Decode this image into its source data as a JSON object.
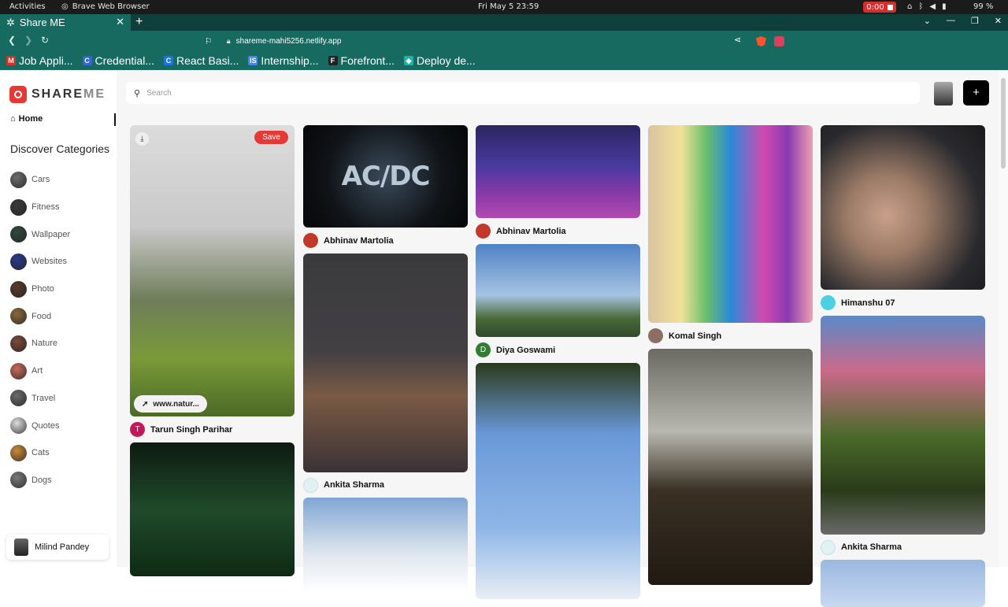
{
  "os": {
    "activities": "Activities",
    "app_name": "Brave Web Browser",
    "clock": "Fri May 5  23:59",
    "rec_time": "0:00",
    "battery": "99 %"
  },
  "browser": {
    "tab_title": "Share ME",
    "new_tab": "+",
    "url": "shareme-mahi5256.netlify.app",
    "bookmarks": [
      {
        "label": "Job Appli...",
        "icon": "mail-icon",
        "color": "#d93025",
        "glyph": "M"
      },
      {
        "label": "Credential...",
        "icon": "credential-icon",
        "color": "#3367d6",
        "glyph": "C"
      },
      {
        "label": "React Basi...",
        "icon": "course-icon",
        "color": "#1a73e8",
        "glyph": "C"
      },
      {
        "label": "Internship...",
        "icon": "internship-icon",
        "color": "#4285f4",
        "glyph": "IS"
      },
      {
        "label": "Forefront...",
        "icon": "forefront-icon",
        "color": "#222222",
        "glyph": "F"
      },
      {
        "label": "Deploy de...",
        "icon": "deploy-icon",
        "color": "#20b2aa",
        "glyph": "◆"
      }
    ]
  },
  "app": {
    "logo_a": "SHARE",
    "logo_b": "ME",
    "home": "Home",
    "discover": "Discover Categories",
    "categories": [
      {
        "label": "Cars",
        "color": "#6d6d6d"
      },
      {
        "label": "Fitness",
        "color": "#3a3a3a"
      },
      {
        "label": "Wallpaper",
        "color": "#2f4a3a"
      },
      {
        "label": "Websites",
        "color": "#2b3a8a"
      },
      {
        "label": "Photo",
        "color": "#5a3a2a"
      },
      {
        "label": "Food",
        "color": "#8a6a3a"
      },
      {
        "label": "Nature",
        "color": "#7a4a3a"
      },
      {
        "label": "Art",
        "color": "#c96a5a"
      },
      {
        "label": "Travel",
        "color": "#6a6a6a"
      },
      {
        "label": "Quotes",
        "color": "#dedede"
      },
      {
        "label": "Cats",
        "color": "#c98a3a"
      },
      {
        "label": "Dogs",
        "color": "#7a7a7a"
      }
    ],
    "user_name": "Milind Pandey",
    "search_placeholder": "Search",
    "add_label": "+",
    "save_label": "Save",
    "link_label": "www.natur..."
  },
  "feed": {
    "col1": [
      {
        "user": "Tarun Singh Parihar",
        "avatar": "T",
        "avatar_color": "#c2185b",
        "bg": "linear-gradient(180deg,#dcdcdc 0%,#c9c9c9 35%,#6f7d5a 60%,#7a9a3a 80%,#4c6a25 100%)",
        "has_save": true
      },
      {
        "user": "",
        "avatar": "",
        "avatar_color": "#fff",
        "bg": "linear-gradient(180deg,#0e1a12 0%,#1f4a2a 50%,#0f2a14 100%)"
      }
    ],
    "col2": [
      {
        "user": "Abhinav Martolia",
        "avatar": "",
        "avatar_color": "#c0392b",
        "bg": "radial-gradient(circle at 50% 50%,#3a4a5a 0%,#101418 60%,#050608 100%)",
        "art": "AC/DC"
      },
      {
        "user": "Ankita Sharma",
        "avatar": "",
        "avatar_color": "#e0f2f1",
        "bg": "linear-gradient(180deg,#3a3a3c 0%,#434044 45%,#7a5a44 65%,#3b3236 100%)"
      },
      {
        "user": "",
        "avatar": "",
        "avatar_color": "#fff",
        "bg": "linear-gradient(180deg,#7fa6d4 0%,#dfe7ee 60%,#ffffff 100%)"
      }
    ],
    "col3": [
      {
        "user": "Abhinav Martolia",
        "avatar": "",
        "avatar_color": "#c0392b",
        "bg": "linear-gradient(180deg,#2b2660 0%,#4a3aa0 45%,#8a3aa8 75%,#b24ab0 100%)"
      },
      {
        "user": "Diya Goswami",
        "avatar": "D",
        "avatar_color": "#2e7d32",
        "bg": "linear-gradient(180deg,#4f82c6 0%,#a7c3e2 55%,#4a6a3a 80%,#2f4a2a 100%)"
      },
      {
        "user": "",
        "avatar": "",
        "avatar_color": "#fff",
        "bg": "linear-gradient(180deg,#2a3a1a 0%,#6a98d8 30%,#8fb6e8 70%,#e8eef4 100%)"
      }
    ],
    "col4": [
      {
        "user": "Komal Singh",
        "avatar": "",
        "avatar_color": "#8d6e63",
        "bg": "linear-gradient(90deg,#d9c3a0 0%,#f1e29a 20%,#6ac06a 35%,#2a8ad8 50%,#d04ab0 70%,#8a3ab0 85%,#f0a0b0 100%)"
      },
      {
        "user": "",
        "avatar": "",
        "avatar_color": "#fff",
        "bg": "linear-gradient(180deg,#6a6a62 0%,#b8b8b0 35%,#3a3024 60%,#201a12 100%)"
      }
    ],
    "col5": [
      {
        "user": "Himanshu 07",
        "avatar": "",
        "avatar_color": "#4dd0e1",
        "bg": "radial-gradient(circle at 40% 55%,#c9a08a 0%,#9a7a66 30%,#2a2a2e 70%,#1a1a1c 100%)"
      },
      {
        "user": "Ankita Sharma",
        "avatar": "",
        "avatar_color": "#e0f2f1",
        "bg": "linear-gradient(180deg,#5a8ac8 0%,#c96a8a 25%,#4a6a2a 55%,#2a3a1a 80%,#6a6a6a 100%)"
      },
      {
        "user": "",
        "avatar": "",
        "avatar_color": "#fff",
        "bg": "linear-gradient(180deg,#9ab8e0 0%,#c8d8f0 100%)"
      }
    ]
  }
}
